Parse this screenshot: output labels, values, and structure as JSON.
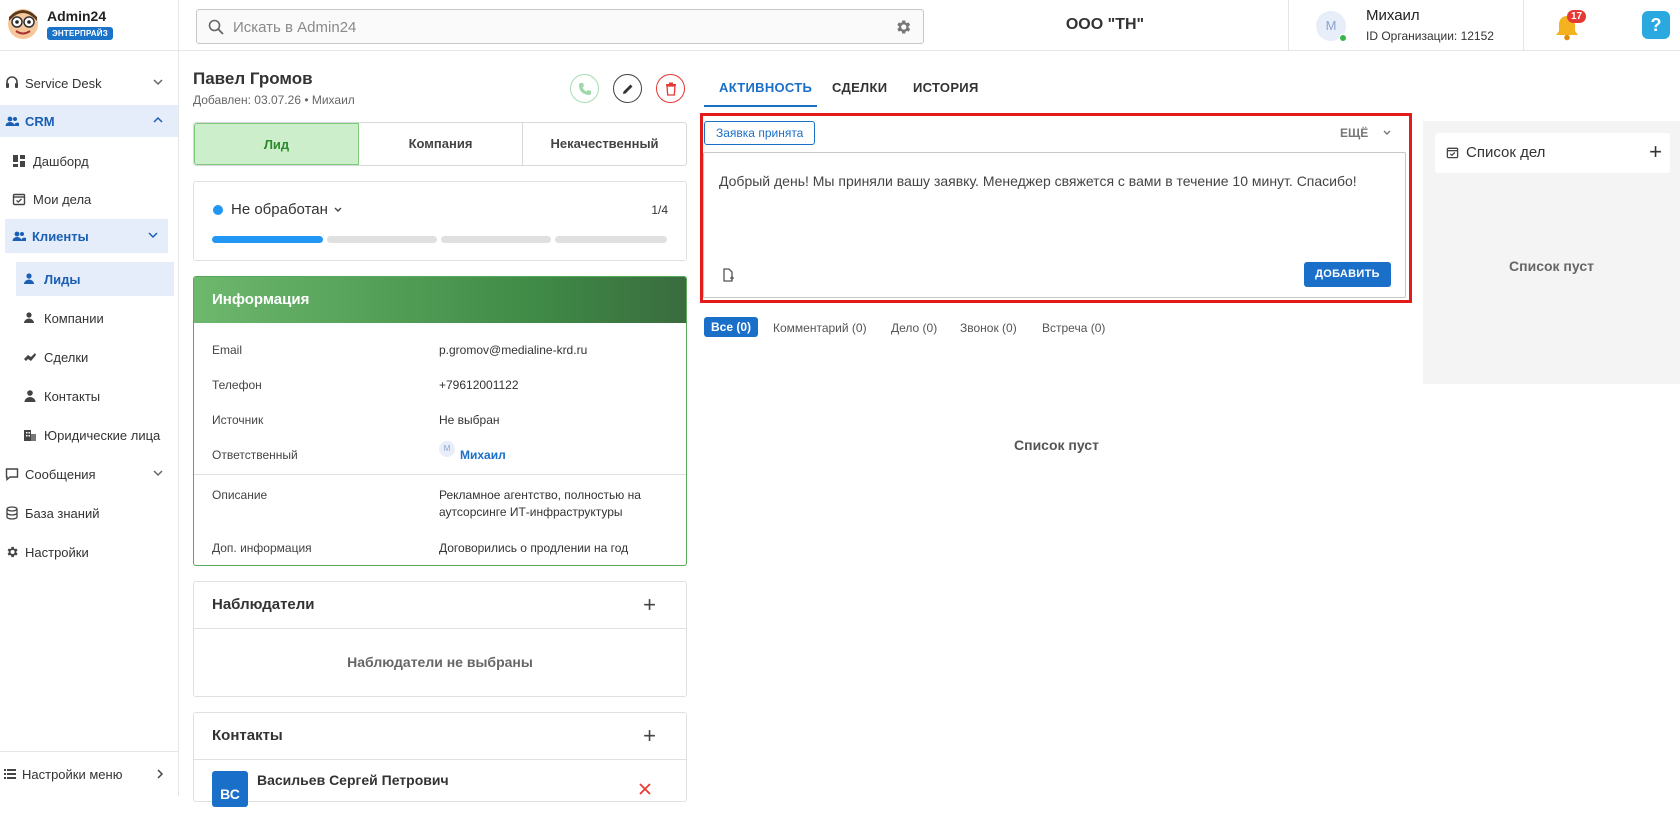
{
  "brand": {
    "name": "Admin24",
    "badge": "ЭНТЕРПРАЙЗ"
  },
  "search": {
    "placeholder": "Искать в Admin24",
    "value": ""
  },
  "header": {
    "org": "ООО \"ТН\"",
    "user_initial": "М",
    "user_name": "Михаил",
    "org_id": "ID Организации: 12152",
    "notifications": "17",
    "help": "?"
  },
  "sidebar": {
    "items": [
      {
        "label": "Service Desk"
      },
      {
        "label": "CRM"
      },
      {
        "label": "Дашборд"
      },
      {
        "label": "Мои дела"
      },
      {
        "label": "Клиенты"
      },
      {
        "label": "Лиды"
      },
      {
        "label": "Компании"
      },
      {
        "label": "Сделки"
      },
      {
        "label": "Контакты"
      },
      {
        "label": "Юридические лица"
      },
      {
        "label": "Сообщения"
      },
      {
        "label": "База знаний"
      },
      {
        "label": "Настройки"
      }
    ],
    "menu_settings": "Настройки меню"
  },
  "lead": {
    "name": "Павел Громов",
    "meta": "Добавлен: 03.07.26 • Михаил",
    "stages": [
      "Лид",
      "Компания",
      "Некачественный"
    ],
    "status": "Не обработан",
    "status_count": "1/4",
    "progress": 0.25
  },
  "info": {
    "title": "Информация",
    "rows": [
      {
        "label": "Email",
        "value": "p.gromov@medialine-krd.ru"
      },
      {
        "label": "Телефон",
        "value": "+79612001122"
      },
      {
        "label": "Источник",
        "value": "Не выбран"
      },
      {
        "label": "Ответственный",
        "value": "Михаил",
        "avatar": "М"
      },
      {
        "label": "Описание",
        "value": "Рекламное агентство, полностью на аутсорсинге ИТ-инфраструктуры"
      },
      {
        "label": "Доп. информация",
        "value": "Договорились о продлении на год"
      }
    ]
  },
  "observers": {
    "title": "Наблюдатели",
    "empty": "Наблюдатели не выбраны"
  },
  "contacts": {
    "title": "Контакты",
    "item_initials": "ВС",
    "item_name": "Васильев Сергей Петрович"
  },
  "tabs": [
    "АКТИВНОСТЬ",
    "СДЕЛКИ",
    "ИСТОРИЯ"
  ],
  "composer": {
    "tag": "Заявка принята",
    "more": "ЕЩЁ",
    "text": "Добрый день! Мы приняли вашу заявку. Менеджер свяжется с вами в течение 10 минут. Спасибо!",
    "add_label": "ДОБАВИТЬ"
  },
  "filters": [
    "Все (0)",
    "Комментарий (0)",
    "Дело (0)",
    "Звонок (0)",
    "Встреча (0)"
  ],
  "activity_empty": "Список пуст",
  "todo": {
    "title": "Список дел",
    "plus": "+",
    "empty": "Список пуст"
  },
  "colors": {
    "accent": "#1a6fc9",
    "lead_green": "#cdeecb",
    "info_green": "#3f8a46",
    "danger": "#e21b1b"
  }
}
